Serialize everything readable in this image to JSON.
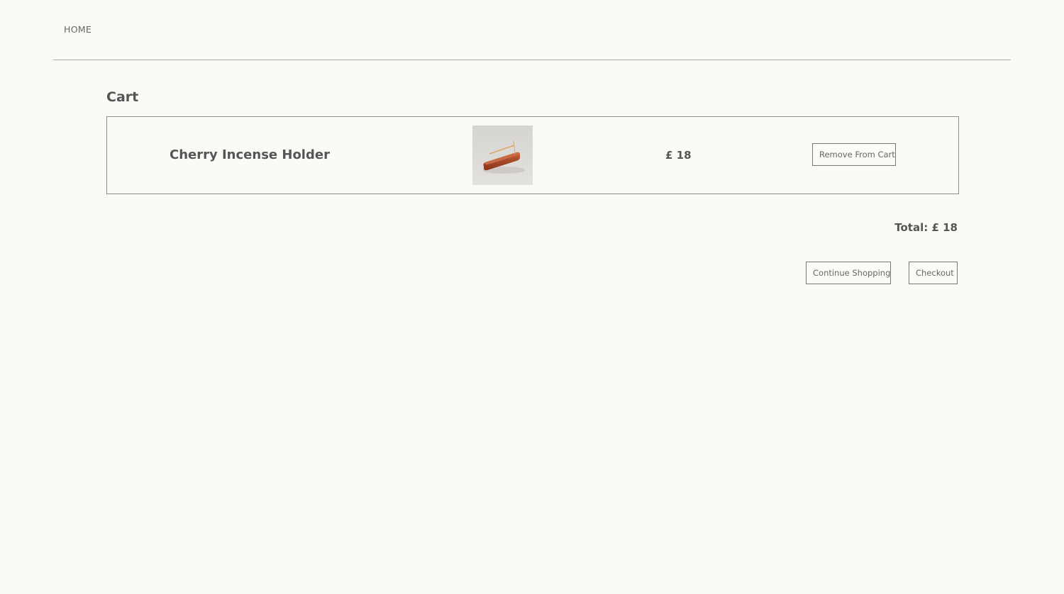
{
  "nav": {
    "home_label": "HOME"
  },
  "cart": {
    "title": "Cart",
    "items": [
      {
        "name": "Cherry Incense Holder",
        "price": "£ 18",
        "remove_label": "Remove From Cart"
      }
    ],
    "total": "Total: £ 18",
    "continue_label": "Continue Shopping",
    "checkout_label": "Checkout"
  },
  "colors": {
    "background": "#fcfaf6",
    "text": "#555555",
    "border": "#8e8e8e",
    "product_wood": "#a9472a"
  }
}
